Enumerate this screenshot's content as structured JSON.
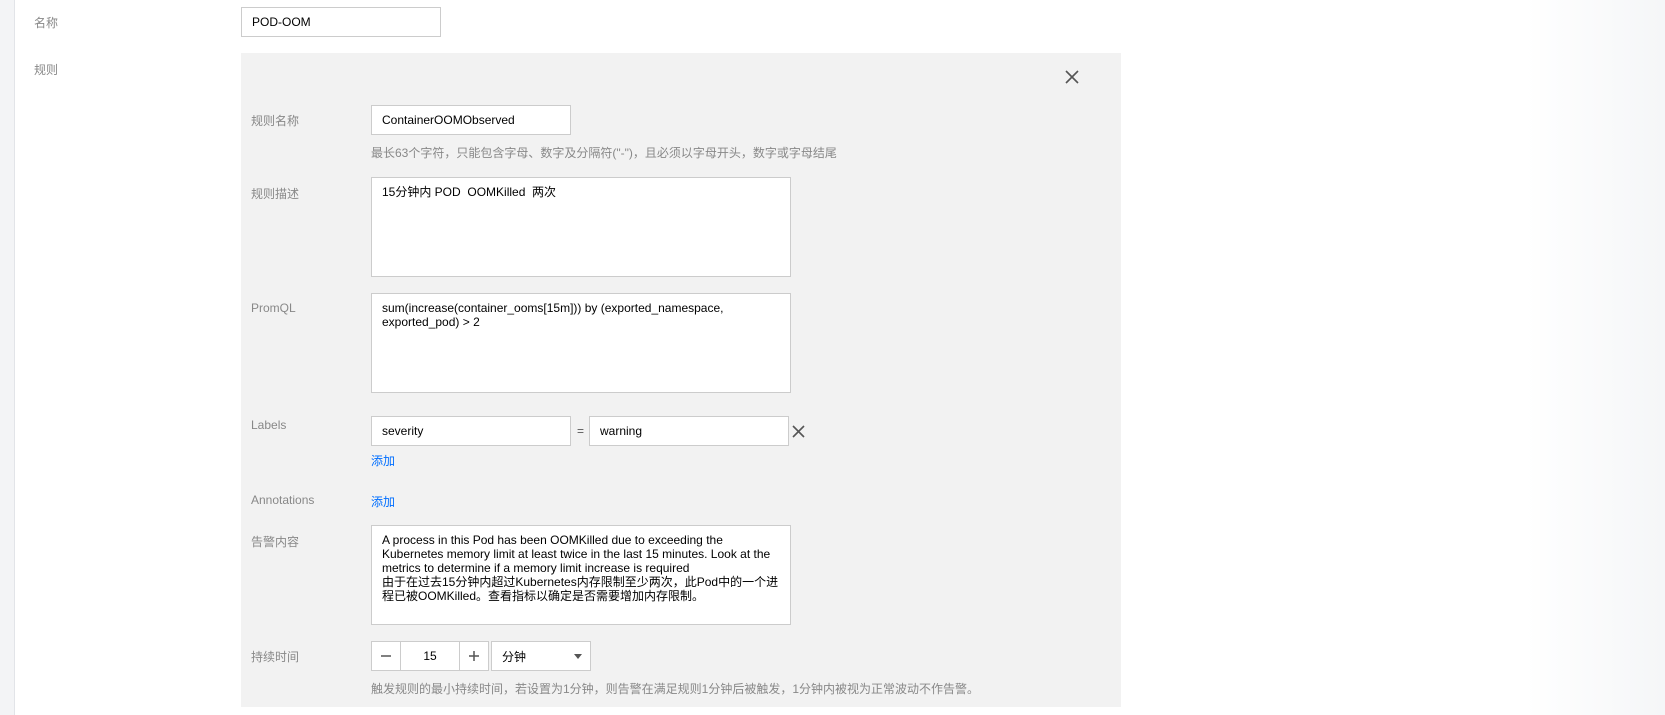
{
  "form": {
    "name_label": "名称",
    "name_value": "POD-OOM",
    "rules_label": "规则"
  },
  "rule": {
    "rule_name_label": "规则名称",
    "rule_name_value": "ContainerOOMObserved",
    "rule_name_hint": "最长63个字符，只能包含字母、数字及分隔符(\"-\")，且必须以字母开头，数字或字母结尾",
    "desc_label": "规则描述",
    "desc_value": "15分钟内 POD  OOMKilled  两次",
    "promql_label": "PromQL",
    "promql_value": "sum(increase(container_ooms[15m])) by (exported_namespace,\nexported_pod) > 2",
    "labels_label": "Labels",
    "label_key": "severity",
    "label_eq": "=",
    "label_value": "warning",
    "labels_add": "添加",
    "annotations_label": "Annotations",
    "annotations_add": "添加",
    "content_label": "告警内容",
    "content_value": "A process in this Pod has been OOMKilled due to exceeding the\nKubernetes memory limit at least twice in the last 15 minutes. Look at the\nmetrics to determine if a memory limit increase is required\n由于在过去15分钟内超过Kubernetes内存限制至少两次，此Pod中的一个进\n程已被OOMKilled。查看指标以确定是否需要增加内存限制。",
    "duration_label": "持续时间",
    "duration_value": "15",
    "duration_unit": "分钟",
    "duration_hint": "触发规则的最小持续时间，若设置为1分钟，则告警在满足规则1分钟后被触发，1分钟内被视为正常波动不作告警。"
  },
  "icons": {
    "close": "close-icon",
    "minus": "minus-icon",
    "plus": "plus-icon",
    "caret": "caret-down-icon"
  },
  "colors": {
    "link": "#006eff",
    "panel_bg": "#f2f2f2",
    "label": "#888888"
  }
}
